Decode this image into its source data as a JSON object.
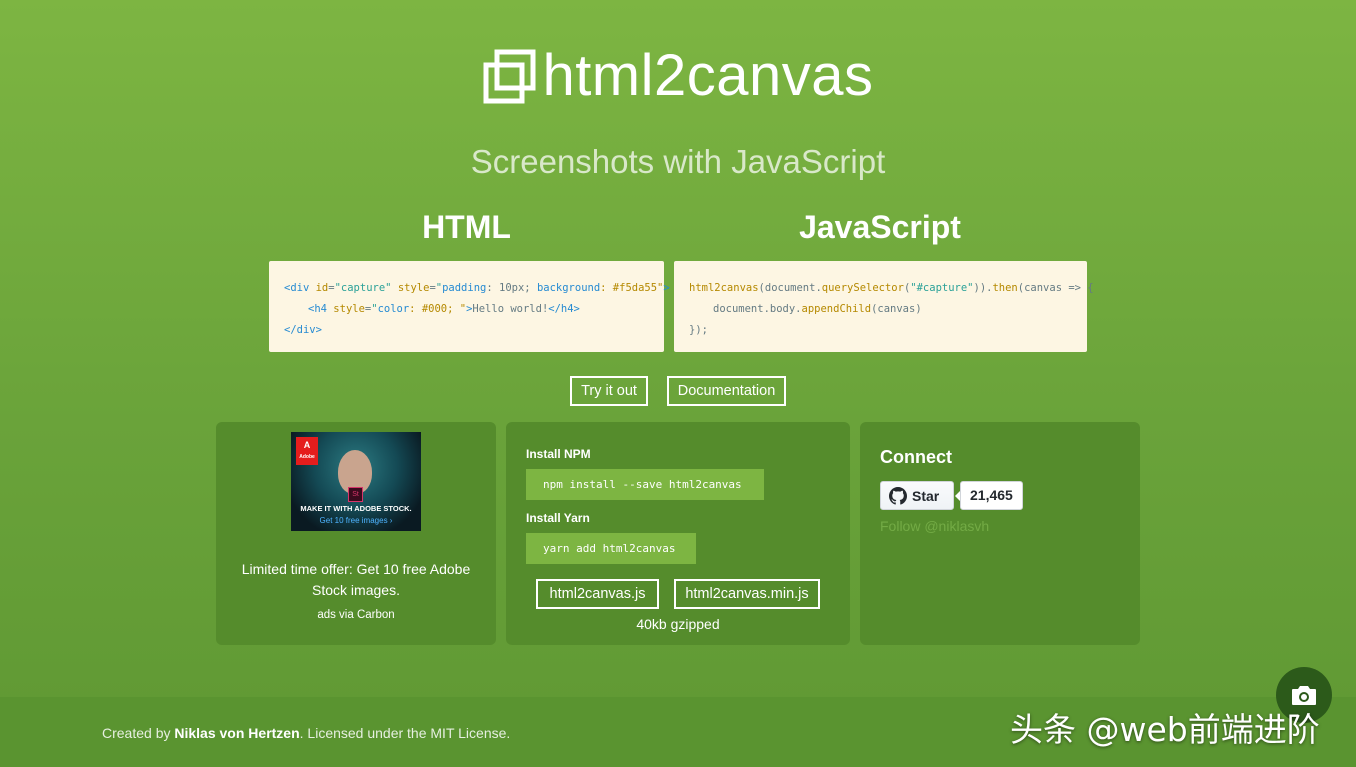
{
  "header": {
    "title": "html2canvas",
    "subtitle": "Screenshots with JavaScript"
  },
  "columns": {
    "html_heading": "HTML",
    "js_heading": "JavaScript"
  },
  "code_html": {
    "l1_open": "<div ",
    "l1_attr1": "id",
    "l1_eq1": "=",
    "l1_val1": "\"capture\"",
    "l1_attr2": " style",
    "l1_eq2": "=",
    "l1_val2a": "\"",
    "l1_val2b": "padding",
    "l1_val2c": ": 10px; ",
    "l1_val2d": "background",
    "l1_val2e": ": #f5da55\"",
    "l1_close": ">",
    "l2_open": "<h4 ",
    "l2_attr": "style",
    "l2_eq": "=",
    "l2_val1": "\"",
    "l2_val2": "color",
    "l2_val3": ": #000; \"",
    "l2_close": ">",
    "l2_text": "Hello world!",
    "l2_end": "</h4>",
    "l3": "</div>"
  },
  "code_js": {
    "l1_fn": "html2canvas",
    "l1_a": "(document.",
    "l1_method": "querySelector",
    "l1_b": "(",
    "l1_str": "\"#capture\"",
    "l1_c": ")).",
    "l1_then": "then",
    "l1_d": "(canvas => {",
    "l2_a": "document.body.",
    "l2_method": "appendChild",
    "l2_b": "(canvas)",
    "l3": "});"
  },
  "buttons": {
    "try": "Try it out",
    "docs": "Documentation"
  },
  "ad": {
    "logo": "Adobe",
    "app": "St",
    "caption1": "MAKE IT WITH ADOBE STOCK.",
    "caption2": "Get 10 free images ›",
    "text": "Limited time offer: Get 10 free Adobe Stock images.",
    "via": "ads via Carbon"
  },
  "install": {
    "npm_label": "Install NPM",
    "npm_cmd": "npm install --save html2canvas",
    "yarn_label": "Install Yarn",
    "yarn_cmd": "yarn add html2canvas",
    "dl1": "html2canvas.js",
    "dl2": "html2canvas.min.js",
    "size": "40kb gzipped"
  },
  "connect": {
    "title": "Connect",
    "star": "Star",
    "stars": "21,465",
    "follow": "Follow @niklasvh"
  },
  "footer": {
    "prefix": "Created by ",
    "author": "Niklas von Hertzen",
    "suffix": ". Licensed under the MIT License."
  },
  "watermark": "头条 @web前端进阶",
  "icons": [
    "html2canvas-logo-icon",
    "github-icon",
    "camera-icon"
  ]
}
